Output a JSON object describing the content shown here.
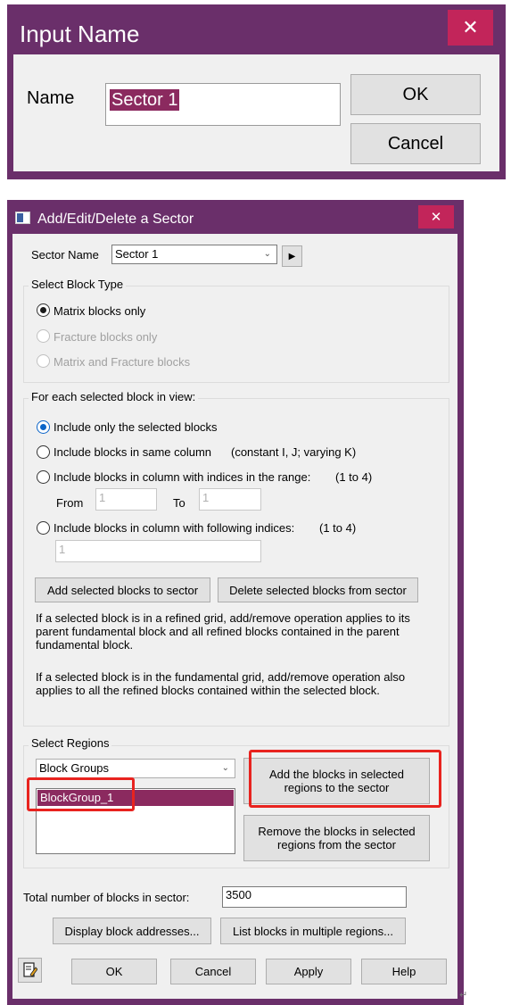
{
  "input_dialog": {
    "title": "Input Name",
    "close_glyph": "✕",
    "name_label": "Name",
    "name_value": "Sector 1",
    "ok_label": "OK",
    "cancel_label": "Cancel"
  },
  "sector_dialog": {
    "title": "Add/Edit/Delete a Sector",
    "close_glyph": "✕",
    "sector_name_label": "Sector Name",
    "sector_name_value": "Sector 1",
    "block_type": {
      "label": "Select Block Type",
      "options": [
        "Matrix blocks only",
        "Fracture blocks only",
        "Matrix and Fracture blocks"
      ]
    },
    "selection": {
      "label": "For each selected block in view:",
      "opt_selected": "Include only the selected blocks",
      "opt_column": "Include blocks in same column",
      "column_note": "(constant I, J; varying K)",
      "opt_range": "Include blocks in column with indices in the range:",
      "range_note": "(1 to 4)",
      "from_label": "From",
      "from_value": "1",
      "to_label": "To",
      "to_value": "1",
      "opt_following": "Include blocks in column with following indices:",
      "following_note": "(1 to 4)",
      "following_value": "1",
      "add_button": "Add selected blocks to sector",
      "delete_button": "Delete selected blocks from sector",
      "note1": "If a selected block is in a refined grid, add/remove operation applies to its parent fundamental block and all refined blocks contained in the parent fundamental block.",
      "note2": "If a selected block is in the fundamental grid, add/remove operation also applies to all the refined blocks contained within the selected  block."
    },
    "regions": {
      "label": "Select Regions",
      "dropdown_value": "Block Groups",
      "list_items": [
        "BlockGroup_1"
      ],
      "add_button": "Add the blocks in selected regions to the sector",
      "remove_button": "Remove the blocks in selected regions from the sector"
    },
    "total_label": "Total number of blocks in sector:",
    "total_value": "3500",
    "display_button": "Display block addresses...",
    "list_button": "List blocks in multiple regions...",
    "ok_label": "OK",
    "cancel_label": "Cancel",
    "apply_label": "Apply",
    "help_label": "Help"
  },
  "colors": {
    "title_bar": "#6a2f6a",
    "close_button": "#c2255a",
    "highlight": "#e8231f",
    "selected_item": "#8b2a5f"
  },
  "corner_mark": "↵"
}
